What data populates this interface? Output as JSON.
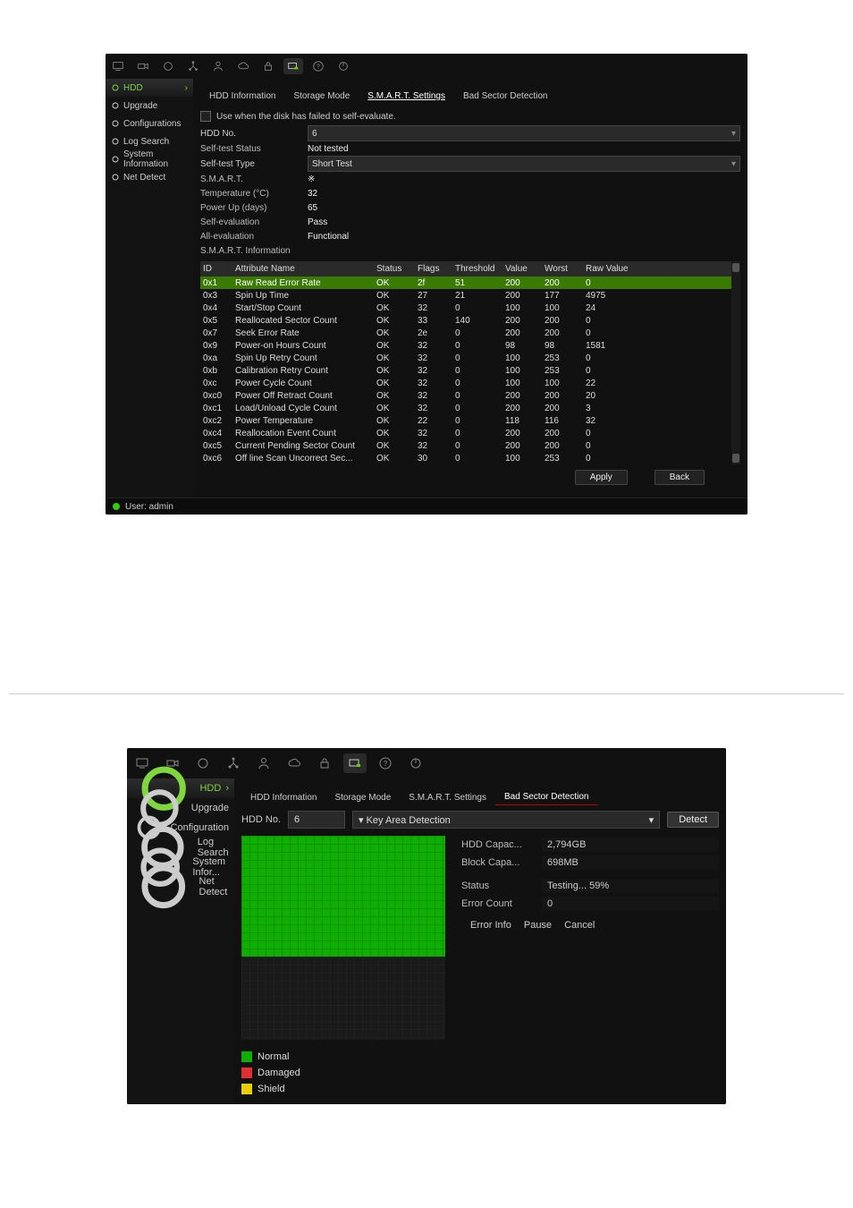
{
  "shot1": {
    "toolbar_icons": [
      "monitor-icon",
      "camera-icon",
      "record-icon",
      "network-icon",
      "user-icon",
      "cloud-icon",
      "lock-icon",
      "display-icon",
      "help-icon",
      "power-icon"
    ],
    "sidebar": {
      "active": "HDD",
      "items": [
        {
          "label": "HDD",
          "icon": "drive-icon"
        },
        {
          "label": "Upgrade",
          "icon": "up-arrow-icon"
        },
        {
          "label": "Configurations",
          "icon": "tools-icon"
        },
        {
          "label": "Log Search",
          "icon": "search-icon"
        },
        {
          "label": "System Information",
          "icon": "info-icon"
        },
        {
          "label": "Net Detect",
          "icon": "netdetect-icon"
        }
      ]
    },
    "tabs": [
      "HDD Information",
      "Storage Mode",
      "S.M.A.R.T. Settings",
      "Bad Sector Detection"
    ],
    "active_tab": "S.M.A.R.T. Settings",
    "checkbox_label": "Use when the disk has failed to self-evaluate.",
    "fields": {
      "hdd_no_label": "HDD No.",
      "hdd_no": "6",
      "self_test_status_label": "Self-test Status",
      "self_test_status": "Not tested",
      "self_test_type_label": "Self-test Type",
      "self_test_type": "Short Test",
      "smart_label": "S.M.A.R.T.",
      "smart": "※",
      "temperature_label": "Temperature (°C)",
      "temperature": "32",
      "power_up_label": "Power Up (days)",
      "power_up": "65",
      "self_eval_label": "Self-evaluation",
      "self_eval": "Pass",
      "all_eval_label": "All-evaluation",
      "all_eval": "Functional",
      "smart_info_label": "S.M.A.R.T. Information"
    },
    "table": {
      "headers": [
        "ID",
        "Attribute Name",
        "Status",
        "Flags",
        "Threshold",
        "Value",
        "Worst",
        "Raw Value"
      ],
      "rows": [
        {
          "id": "0x1",
          "name": "Raw Read Error Rate",
          "status": "OK",
          "flags": "2f",
          "threshold": "51",
          "value": "200",
          "worst": "200",
          "raw": "0",
          "hi": true
        },
        {
          "id": "0x3",
          "name": "Spin Up Time",
          "status": "OK",
          "flags": "27",
          "threshold": "21",
          "value": "200",
          "worst": "177",
          "raw": "4975"
        },
        {
          "id": "0x4",
          "name": "Start/Stop Count",
          "status": "OK",
          "flags": "32",
          "threshold": "0",
          "value": "100",
          "worst": "100",
          "raw": "24"
        },
        {
          "id": "0x5",
          "name": "Reallocated Sector Count",
          "status": "OK",
          "flags": "33",
          "threshold": "140",
          "value": "200",
          "worst": "200",
          "raw": "0"
        },
        {
          "id": "0x7",
          "name": "Seek Error Rate",
          "status": "OK",
          "flags": "2e",
          "threshold": "0",
          "value": "200",
          "worst": "200",
          "raw": "0"
        },
        {
          "id": "0x9",
          "name": "Power-on Hours Count",
          "status": "OK",
          "flags": "32",
          "threshold": "0",
          "value": "98",
          "worst": "98",
          "raw": "1581"
        },
        {
          "id": "0xa",
          "name": "Spin Up Retry Count",
          "status": "OK",
          "flags": "32",
          "threshold": "0",
          "value": "100",
          "worst": "253",
          "raw": "0"
        },
        {
          "id": "0xb",
          "name": "Calibration Retry Count",
          "status": "OK",
          "flags": "32",
          "threshold": "0",
          "value": "100",
          "worst": "253",
          "raw": "0"
        },
        {
          "id": "0xc",
          "name": "Power Cycle Count",
          "status": "OK",
          "flags": "32",
          "threshold": "0",
          "value": "100",
          "worst": "100",
          "raw": "22"
        },
        {
          "id": "0xc0",
          "name": "Power Off Retract Count",
          "status": "OK",
          "flags": "32",
          "threshold": "0",
          "value": "200",
          "worst": "200",
          "raw": "20"
        },
        {
          "id": "0xc1",
          "name": "Load/Unload Cycle Count",
          "status": "OK",
          "flags": "32",
          "threshold": "0",
          "value": "200",
          "worst": "200",
          "raw": "3"
        },
        {
          "id": "0xc2",
          "name": "Power Temperature",
          "status": "OK",
          "flags": "22",
          "threshold": "0",
          "value": "118",
          "worst": "116",
          "raw": "32"
        },
        {
          "id": "0xc4",
          "name": "Reallocation Event Count",
          "status": "OK",
          "flags": "32",
          "threshold": "0",
          "value": "200",
          "worst": "200",
          "raw": "0"
        },
        {
          "id": "0xc5",
          "name": "Current Pending Sector Count",
          "status": "OK",
          "flags": "32",
          "threshold": "0",
          "value": "200",
          "worst": "200",
          "raw": "0"
        },
        {
          "id": "0xc6",
          "name": "Off line Scan Uncorrect Sec...",
          "status": "OK",
          "flags": "30",
          "threshold": "0",
          "value": "100",
          "worst": "253",
          "raw": "0"
        }
      ]
    },
    "buttons": {
      "apply": "Apply",
      "back": "Back"
    },
    "statusbar": {
      "user_label": "User: admin"
    }
  },
  "shot2": {
    "toolbar_icons": [
      "monitor-icon",
      "camera-icon",
      "record-icon",
      "network-icon",
      "user-icon",
      "cloud-icon",
      "lock-icon",
      "display-icon",
      "help-icon",
      "power-icon"
    ],
    "sidebar": {
      "active": "HDD",
      "items": [
        {
          "label": "HDD",
          "icon": "drive-icon"
        },
        {
          "label": "Upgrade",
          "icon": "up-arrow-icon"
        },
        {
          "label": "Configuration",
          "icon": "tools-icon"
        },
        {
          "label": "Log Search",
          "icon": "search-icon"
        },
        {
          "label": "System Infor...",
          "icon": "info-icon"
        },
        {
          "label": "Net Detect",
          "icon": "netdetect-icon"
        }
      ]
    },
    "tabs": [
      "HDD Information",
      "Storage Mode",
      "S.M.A.R.T. Settings",
      "Bad Sector Detection"
    ],
    "active_tab": "Bad Sector Detection",
    "hdd_no_label": "HDD No.",
    "hdd_no": "6",
    "detection_mode_label": "Key Area Detection",
    "detect_btn": "Detect",
    "info": {
      "hdd_capac_label": "HDD Capac...",
      "hdd_capac": "2,794GB",
      "block_capa_label": "Block Capa...",
      "block_capa": "698MB",
      "status_label": "Status",
      "status": "Testing... 59%",
      "error_count_label": "Error Count",
      "error_count": "0"
    },
    "buttons": {
      "error_info": "Error Info",
      "pause": "Pause",
      "cancel": "Cancel"
    },
    "legend": {
      "normal": "Normal",
      "damaged": "Damaged",
      "shield": "Shield"
    },
    "scan_percent": 59
  }
}
